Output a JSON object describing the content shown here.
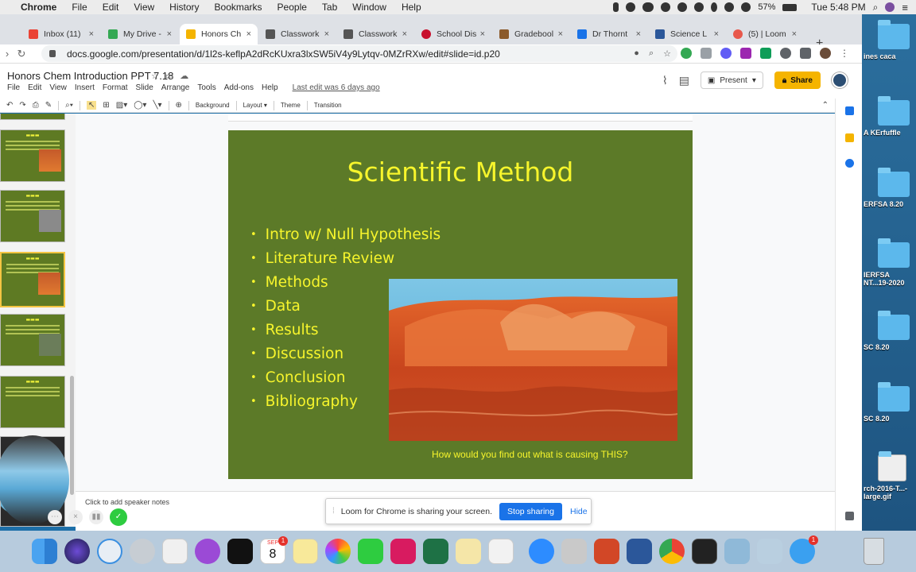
{
  "menubar": {
    "app": "Chrome",
    "items": [
      "File",
      "Edit",
      "View",
      "History",
      "Bookmarks",
      "People",
      "Tab",
      "Window",
      "Help"
    ],
    "battery": "57%",
    "clock": "Tue 5:48 PM"
  },
  "tabs": [
    {
      "label": "Inbox (11)",
      "color": "#ea4335"
    },
    {
      "label": "My Drive -",
      "color": "#34a853"
    },
    {
      "label": "Honors Ch",
      "color": "#f4b400"
    },
    {
      "label": "Classwork",
      "color": "#555555"
    },
    {
      "label": "Classwork",
      "color": "#555555"
    },
    {
      "label": "School Dis",
      "color": "#c8102e"
    },
    {
      "label": "Gradebool",
      "color": "#8b5a2b"
    },
    {
      "label": "Dr Thornt",
      "color": "#1a73e8"
    },
    {
      "label": "Science L",
      "color": "#2b579a"
    },
    {
      "label": "(5) | Loom",
      "color": "#e8584b"
    }
  ],
  "omnibox": {
    "url": "docs.google.com/presentation/d/1l2s-keflpA2dRcKUxra3lxSW5iV4y9Lytqv-0MZrRXw/edit#slide=id.p20"
  },
  "doc": {
    "title": "Honors Chem Introduction PPT 7.18",
    "menus": [
      "File",
      "Edit",
      "View",
      "Insert",
      "Format",
      "Slide",
      "Arrange",
      "Tools",
      "Add-ons",
      "Help"
    ],
    "last_edit": "Last edit was 6 days ago",
    "present": "Present",
    "share": "Share"
  },
  "edit_toolbar": {
    "background": "Background",
    "layout": "Layout",
    "theme": "Theme",
    "transition": "Transition"
  },
  "slide": {
    "title": "Scientific Method",
    "bullets": [
      "Intro w/ Null Hypothesis",
      "Literature Review",
      "Methods",
      "Data",
      "Results",
      "Discussion",
      "Conclusion",
      "Bibliography"
    ],
    "caption": "How would you find out what is causing THIS?",
    "bg_color": "#5c7a28",
    "text_color": "#f7f52c"
  },
  "notes_placeholder": "Click to add speaker notes",
  "loom": {
    "message": "Loom for Chrome is sharing your screen.",
    "stop": "Stop sharing",
    "hide": "Hide"
  },
  "desktop_items": [
    "ines caca",
    "A KErfuffle",
    "ERFSA 8.20",
    "IERFSA NT...19-2020",
    "SC 8.20",
    "SC 8.20",
    "rch-2016-T...-large.gif"
  ],
  "dock": {
    "calendar_month": "SEP",
    "calendar_day": "8",
    "calendar_badge": "1",
    "messages_badge": "1"
  }
}
